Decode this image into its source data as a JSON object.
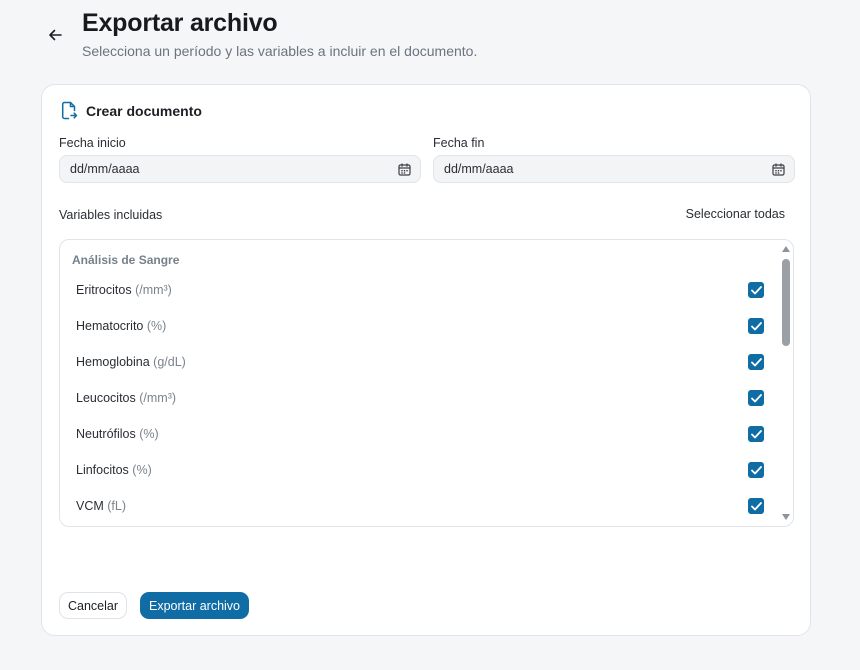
{
  "header": {
    "title": "Exportar archivo",
    "subtitle": "Selecciona un período y las variables a incluir en el documento."
  },
  "card": {
    "title": "Crear documento",
    "start_date": {
      "label": "Fecha inicio",
      "placeholder": "dd/mm/aaaa"
    },
    "end_date": {
      "label": "Fecha fin",
      "placeholder": "dd/mm/aaaa"
    },
    "variables_label": "Variables incluidas",
    "select_all": "Seleccionar todas",
    "group": {
      "title": "Análisis de Sangre",
      "items": [
        {
          "name": "Eritrocitos",
          "unit": "(/mm³)",
          "checked": true
        },
        {
          "name": "Hematocrito",
          "unit": "(%)",
          "checked": true
        },
        {
          "name": "Hemoglobina",
          "unit": "(g/dL)",
          "checked": true
        },
        {
          "name": "Leucocitos",
          "unit": "(/mm³)",
          "checked": true
        },
        {
          "name": "Neutrófilos",
          "unit": "(%)",
          "checked": true
        },
        {
          "name": "Linfocitos",
          "unit": "(%)",
          "checked": true
        },
        {
          "name": "VCM",
          "unit": "(fL)",
          "checked": true
        }
      ]
    },
    "actions": {
      "cancel": "Cancelar",
      "export": "Exportar archivo"
    }
  },
  "icons": {
    "back": "arrow-left-icon",
    "document": "file-export-icon",
    "calendar": "calendar-icon",
    "check": "checkmark-icon"
  },
  "colors": {
    "accent": "#0f6ca5",
    "background": "#f5f6f8",
    "card": "#ffffff"
  }
}
